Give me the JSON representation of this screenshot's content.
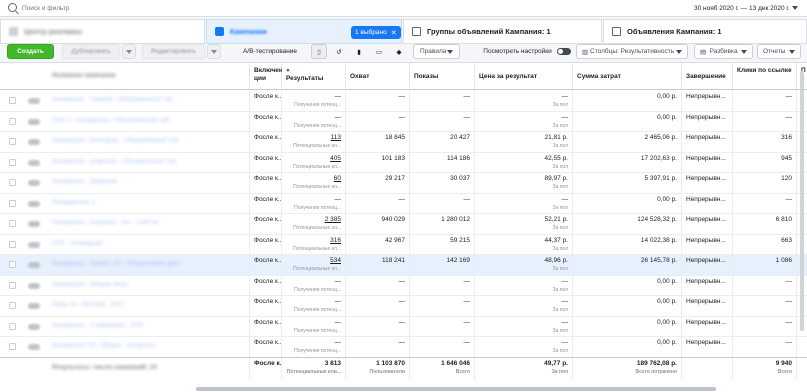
{
  "search": {
    "placeholder": "Поиск и фильтр"
  },
  "date_range": "30 нояб 2020 г. — 13 дек 2020 г.",
  "tabs": {
    "accounts": "Центр рекламы",
    "campaigns": "Кампании",
    "selected_badge": "1 выбрано",
    "adsets": "Группы объявлений Кампания: 1",
    "ads": "Объявления Кампания: 1"
  },
  "toolbar": {
    "create": "Создать",
    "duplicate": "Дублировать",
    "edit": "Редактировать",
    "ab_test": "A/B-тестирование",
    "rules": "Правила",
    "view_settings": "Посмотреть настройки",
    "columns": "Столбцы: Результативность",
    "breakdown": "Разбивка",
    "reports": "Отчеты"
  },
  "columns": {
    "name": "Название кампании",
    "delivery": "Включение ции",
    "results": "Результаты",
    "reach": "Охват",
    "impressions": "Показы",
    "cost_per_result": "Цена за результат",
    "amount_spent": "Сумма затрат",
    "ends": "Завершение",
    "link_clicks": "Клики по ссылке",
    "next": "П с"
  },
  "rows": [
    {
      "name": "Конверсии - Тамбов - Обновленный таб",
      "delivery": "Фосле к...",
      "results": "—",
      "results_sub": "Получения потенц...",
      "reach": "—",
      "impressions": "—",
      "cpr": "—",
      "cpr_sub": "За пол",
      "spent": "0,00 р.",
      "ends": "Непрерывн...",
      "clicks": "—",
      "hl": false
    },
    {
      "name": "ПЛУ Л - Конверсии - Обновленный таб",
      "delivery": "Фосле к...",
      "results": "—",
      "results_sub": "Получения потенц...",
      "reach": "—",
      "impressions": "—",
      "cpr": "—",
      "cpr_sub": "За пол",
      "spent": "0,00 р.",
      "ends": "Непрерывн...",
      "clicks": "—",
      "hl": false
    },
    {
      "name": "Конверсии - Белгород - Обновленный таб",
      "delivery": "Фосле к...",
      "results": "113",
      "results_sub": "Потенциальные кл...",
      "reach": "18 845",
      "impressions": "20 427",
      "cpr": "21,81 р.",
      "cpr_sub": "За пол",
      "spent": "2 465,06 р.",
      "ends": "Непрерывн...",
      "clicks": "316",
      "hl": false
    },
    {
      "name": "Конверсии - широкая - Обновленный таб",
      "delivery": "Фосле к...",
      "results": "405",
      "results_sub": "Потенциальные кл...",
      "reach": "101 183",
      "impressions": "114 186",
      "cpr": "42,55 р.",
      "cpr_sub": "За пол",
      "spent": "17 202,63 р.",
      "ends": "Непрерывн...",
      "clicks": "945",
      "hl": false
    },
    {
      "name": "Конверсии - Широкая",
      "delivery": "Фосле к...",
      "results": "60",
      "results_sub": "Потенциальные кл...",
      "reach": "29 217",
      "impressions": "30 037",
      "cpr": "89,97 р.",
      "cpr_sub": "За пол",
      "spent": "5 397,91 р.",
      "ends": "Непрерывн...",
      "clicks": "120",
      "hl": false
    },
    {
      "name": "Ремаркетинг 1",
      "delivery": "Фосле к...",
      "results": "—",
      "results_sub": "Получения потенц...",
      "reach": "—",
      "impressions": "—",
      "cpr": "—",
      "cpr_sub": "За пол",
      "spent": "0,00 р.",
      "ends": "Непрерывн...",
      "clicks": "—",
      "hl": false
    },
    {
      "name": "Конверсии - широкая - гео - сайт.ии",
      "delivery": "Фосле к...",
      "results": "2 385",
      "results_sub": "Потенциальные кл...",
      "reach": "940 029",
      "impressions": "1 280 012",
      "cpr": "52,21 р.",
      "cpr_sub": "За пол",
      "spent": "124 528,32 р.",
      "ends": "Непрерывн...",
      "clicks": "6 810",
      "hl": false
    },
    {
      "name": "ПЛУ - Конверсии",
      "delivery": "Фосле к...",
      "results": "316",
      "results_sub": "Потенциальные кл...",
      "reach": "42 967",
      "impressions": "59 215",
      "cpr": "44,37 р.",
      "cpr_sub": "За пол",
      "spent": "14 022,38 р.",
      "ends": "Непрерывн...",
      "clicks": "663",
      "hl": false
    },
    {
      "name": "Конверсии - Проект 15 - Лендинговая дата",
      "delivery": "Фосле к...",
      "results": "534",
      "results_sub": "Потенциальные кл...",
      "reach": "118 241",
      "impressions": "142 169",
      "cpr": "48,96 р.",
      "cpr_sub": "За пол",
      "spent": "26 145,78 р.",
      "ends": "Непрерывн...",
      "clicks": "1 086",
      "hl": true
    },
    {
      "name": "Конверсии - Общая тема",
      "delivery": "Фосле к...",
      "results": "—",
      "results_sub": "Получения потенц...",
      "reach": "—",
      "impressions": "—",
      "cpr": "—",
      "cpr_sub": "За пол",
      "spent": "0,00 р.",
      "ends": "Непрерывн...",
      "clicks": "—",
      "hl": false
    },
    {
      "name": "Лиды за - Москва - ЛАЛ",
      "delivery": "Фосле к...",
      "results": "—",
      "results_sub": "Получения потенц...",
      "reach": "—",
      "impressions": "—",
      "cpr": "—",
      "cpr_sub": "За пол",
      "spent": "0,00 р.",
      "ends": "Непрерывн...",
      "clicks": "—",
      "hl": false
    },
    {
      "name": "Конверсии - 2 кампания - ЛАЛ",
      "delivery": "Фосле к...",
      "results": "—",
      "results_sub": "Получения потенц...",
      "reach": "—",
      "impressions": "—",
      "cpr": "—",
      "cpr_sub": "За пол",
      "spent": "0,00 р.",
      "ends": "Непрерывн...",
      "clicks": "—",
      "hl": false
    },
    {
      "name": "Конверсии ПЛ - общие - интересы",
      "delivery": "Фосле к...",
      "results": "—",
      "results_sub": "Получения потенц...",
      "reach": "—",
      "impressions": "—",
      "cpr": "—",
      "cpr_sub": "За пол",
      "spent": "0,00 р.",
      "ends": "Непрерывн...",
      "clicks": "—",
      "hl": false
    },
    {
      "name": "Конверсии ПЛ - общие - лал",
      "delivery": "Фосле к...",
      "results": "—",
      "results_sub": "Получения потенц...",
      "reach": "—",
      "impressions": "—",
      "cpr": "—",
      "cpr_sub": "За пол",
      "spent": "0,00 р.",
      "ends": "Непрерывн...",
      "clicks": "—",
      "hl": false
    }
  ],
  "footer": {
    "label": "Результаты: число кампаний: 23",
    "delivery": "Фосле к...",
    "results": "3 813",
    "results_sub": "Потенциальные кли...",
    "reach": "1 103 870",
    "reach_sub": "Пользователи",
    "impressions": "1 646 046",
    "impressions_sub": "Всего",
    "cpr": "49,77 р.",
    "cpr_sub": "За пол",
    "spent": "189 762,08 р.",
    "spent_sub": "Всего потрачено",
    "clicks": "9 940",
    "clicks_sub": "Всего"
  },
  "colors": {
    "accent": "#1877f2",
    "create": "#42b72a",
    "highlight_row": "#e7f0fd"
  }
}
